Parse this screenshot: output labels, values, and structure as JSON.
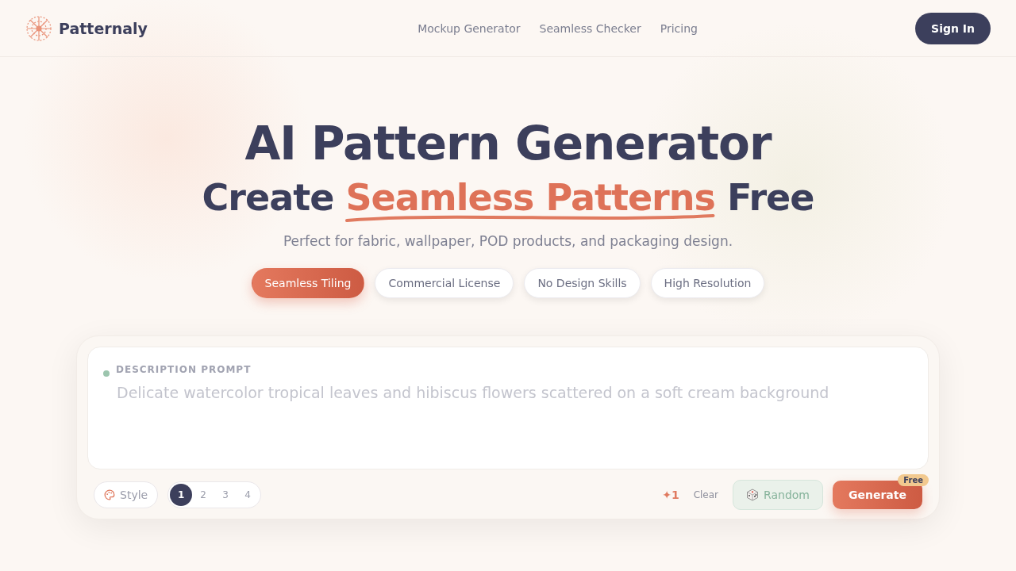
{
  "nav": {
    "brand": "Patternaly",
    "links": [
      "Mockup Generator",
      "Seamless Checker",
      "Pricing"
    ],
    "sign_in": "Sign In"
  },
  "hero": {
    "title": "AI Pattern Generator",
    "subtitle": {
      "before": "Create ",
      "accent": "Seamless Patterns",
      "after": " Free"
    },
    "tagline": "Perfect for fabric, wallpaper, POD products, and packaging design."
  },
  "features": [
    {
      "label": "Seamless Tiling",
      "selected": true
    },
    {
      "label": "Commercial License",
      "selected": false
    },
    {
      "label": "No Design Skills",
      "selected": false
    },
    {
      "label": "High Resolution",
      "selected": false
    }
  ],
  "prompt": {
    "label": "DESCRIPTION PROMPT",
    "placeholder": "Delicate watercolor tropical leaves and hibiscus flowers scattered on a soft cream background"
  },
  "toolbar": {
    "style": "Style",
    "counts": [
      {
        "label": "1",
        "selected": true
      },
      {
        "label": "2",
        "selected": false
      },
      {
        "label": "3",
        "selected": false
      },
      {
        "label": "4",
        "selected": false
      }
    ],
    "credits": "✦1",
    "clear": "Clear",
    "random": "Random",
    "generate": "Generate",
    "badge": "Free"
  }
}
